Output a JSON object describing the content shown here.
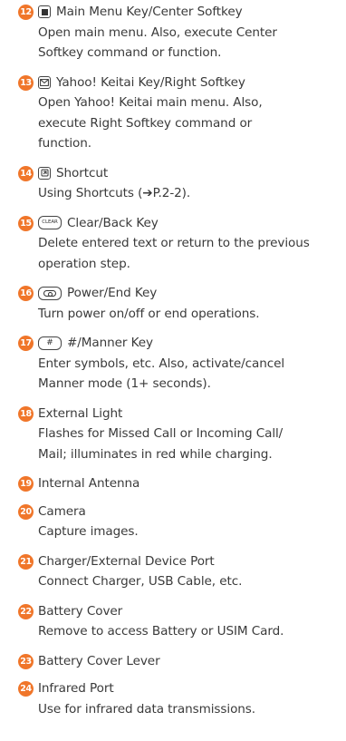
{
  "entries": [
    {
      "num": "12",
      "icon": "center-softkey-icon",
      "title": "Main Menu Key/Center Softkey",
      "desc": [
        "Open main menu. Also, execute Center",
        "Softkey command or function."
      ]
    },
    {
      "num": "13",
      "icon": "mail-key-icon",
      "title": "Yahoo! Keitai Key/Right Softkey",
      "desc": [
        "Open Yahoo! Keitai main menu. Also,",
        "execute Right Softkey command or",
        "function."
      ]
    },
    {
      "num": "14",
      "icon": "shortcut-key-icon",
      "title": "Shortcut",
      "desc": [
        "Using Shortcuts (➔P.2-2)."
      ]
    },
    {
      "num": "15",
      "icon": "clear-key-icon",
      "title": "Clear/Back Key",
      "icon_text": "CLEAR",
      "desc": [
        "Delete entered text or return to the previous",
        "operation step."
      ]
    },
    {
      "num": "16",
      "icon": "power-key-icon",
      "title": "Power/End Key",
      "desc": [
        "Turn power on/off or end operations."
      ]
    },
    {
      "num": "17",
      "icon": "manner-key-icon",
      "title": "#/Manner Key",
      "icon_text": "#",
      "desc": [
        "Enter symbols, etc. Also, activate/cancel",
        "Manner mode (1+ seconds)."
      ]
    },
    {
      "num": "18",
      "title": "External Light",
      "desc": [
        "Flashes for Missed Call or Incoming Call/",
        "Mail; illuminates in red while charging."
      ]
    },
    {
      "num": "19",
      "title": "Internal Antenna",
      "desc": []
    },
    {
      "num": "20",
      "title": "Camera",
      "desc": [
        "Capture images."
      ]
    },
    {
      "num": "21",
      "title": "Charger/External Device Port",
      "desc": [
        "Connect Charger, USB Cable, etc."
      ]
    },
    {
      "num": "22",
      "title": "Battery Cover",
      "desc": [
        "Remove to access Battery or USIM Card."
      ]
    },
    {
      "num": "23",
      "title": "Battery Cover Lever",
      "desc": []
    },
    {
      "num": "24",
      "title": "Infrared Port",
      "desc": [
        "Use for infrared data transmissions."
      ]
    }
  ],
  "colors": {
    "badge": "#f0762a",
    "text": "#3a3a3a"
  }
}
